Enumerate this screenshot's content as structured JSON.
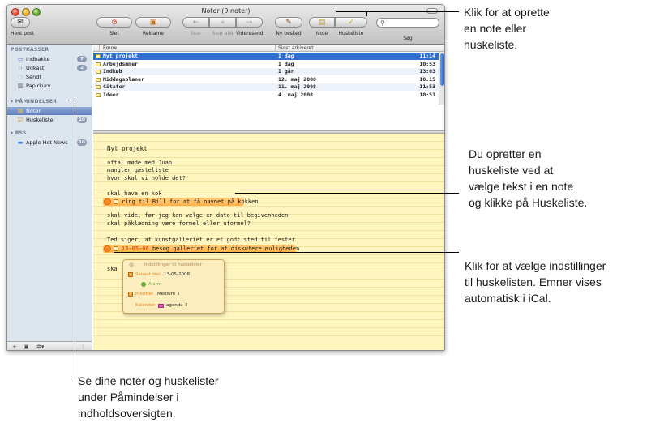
{
  "window": {
    "title": "Noter (9 noter)"
  },
  "toolbar": {
    "get_mail": "Hent post",
    "delete": "Slet",
    "junk": "Reklame",
    "reply": "Svar",
    "reply_all": "Svar alle",
    "forward": "Videresend",
    "new_message": "Ny besked",
    "note": "Note",
    "todo": "Huskeliste",
    "search_label": "Søg",
    "search_placeholder": ""
  },
  "sidebar": {
    "mailboxes_header": "POSTKASSER",
    "reminders_header": "PÅMINDELSER",
    "rss_header": "RSS",
    "items": [
      {
        "label": "Indbakke",
        "badge": "7"
      },
      {
        "label": "Udkast",
        "badge": "2"
      },
      {
        "label": "Sendt",
        "badge": ""
      },
      {
        "label": "Papirkurv",
        "badge": ""
      },
      {
        "label": "Noter",
        "badge": ""
      },
      {
        "label": "Huskeliste",
        "badge": "10"
      },
      {
        "label": "Apple Hot News",
        "badge": "10"
      }
    ]
  },
  "list": {
    "columns": [
      "Emne",
      "Sidst arkiveret"
    ],
    "rows": [
      {
        "subject": "Nyt projekt",
        "date": "I dag",
        "time": "11:14"
      },
      {
        "subject": "Arbejdsmmer",
        "date": "I dag",
        "time": "10:53"
      },
      {
        "subject": "Indkøb",
        "date": "I går",
        "time": "13:03"
      },
      {
        "subject": "Middagsplaner",
        "date": "12. maj 2008",
        "time": "10:15"
      },
      {
        "subject": "Citater",
        "date": "11. maj 2008",
        "time": "11:53"
      },
      {
        "subject": "Ideer",
        "date": "4. maj 2008",
        "time": "10:51"
      }
    ]
  },
  "note": {
    "title": "Nyt projekt",
    "lines": [
      "aftal møde med Juan",
      "mangler gæsteliste",
      "hvor skal vi holde det?",
      "skal have en kok",
      "skal vide, før jeg kan vælge en dato til begivenheden",
      "skal påklædning være formel eller uformel?",
      "Ted siger, at kunstgalleriet er et godt sted til fester",
      "ska"
    ],
    "todo1": "ring til Bill for at få navnet på kokken",
    "todo2_date": "13-05-08",
    "todo2_text": "besøg galleriet for at diskutere muligheden"
  },
  "popup": {
    "title": "Indstillinger til huskelister",
    "due_label": "Senest den",
    "due_value": "13-05-2008",
    "alarm_label": "Alarm",
    "priority_label": "Prioritet",
    "priority_value": "Medium",
    "calendar_label": "Kalender",
    "calendar_value": "agenda"
  },
  "callouts": {
    "top": [
      "Klik for at oprette",
      "en note eller",
      "huskeliste."
    ],
    "middle": [
      "Du opretter en",
      "huskeliste ved at",
      "vælge tekst i en note",
      "og klikke på Huskeliste."
    ],
    "lower": [
      "Klik for at vælge indstillinger",
      "til huskelisten. Emner vises",
      "automatisk i iCal."
    ],
    "bottom": [
      "Se dine noter og huskelister",
      "under Påmindelser i",
      "indholdsoversigten."
    ]
  },
  "colors": {
    "note_paper": "#fff6bf",
    "selection_blue": "#2f6fd1",
    "todo_highlight": "#ffb04a",
    "due_date": "#e2571b"
  }
}
